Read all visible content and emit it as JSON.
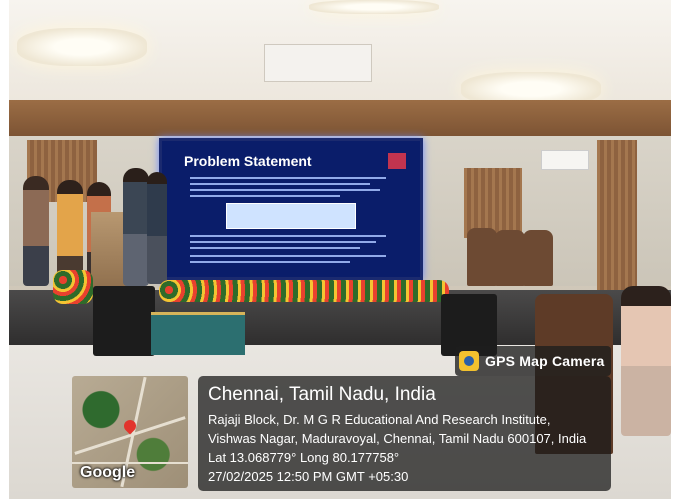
{
  "scene": {
    "slide_title": "Problem Statement"
  },
  "overlay": {
    "app_name": "GPS Map Camera",
    "app_icon": "camera-icon",
    "city": "Chennai, Tamil Nadu, India",
    "address_line1": "Rajaji Block, Dr. M G R Educational And Research Institute,",
    "address_line2": "Vishwas Nagar, Maduravoyal, Chennai, Tamil Nadu 600107, India",
    "coordinates": "Lat 13.068779° Long 80.177758°",
    "timestamp": "27/02/2025 12:50 PM GMT +05:30",
    "map_brand": "Google"
  }
}
